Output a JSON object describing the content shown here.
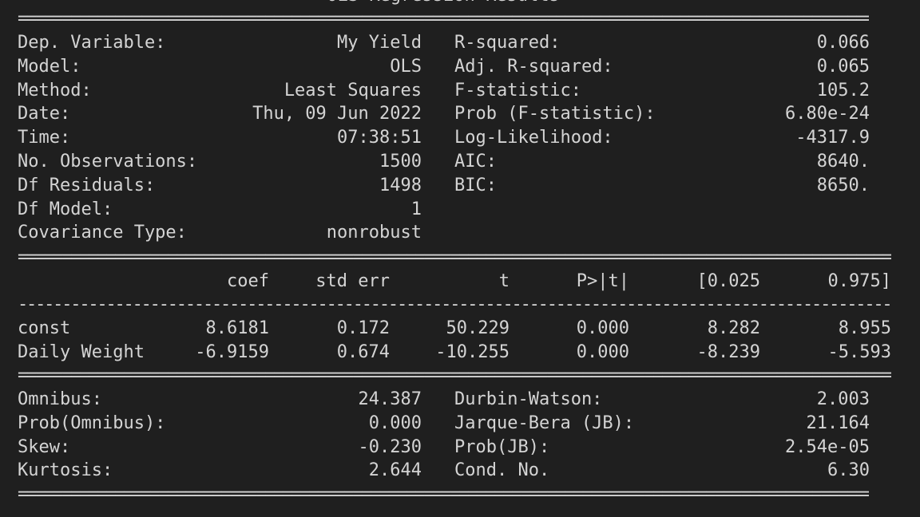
{
  "title": "OLS Regression Results",
  "rule_double": "==========================================================================================================",
  "rule_single": "----------------------------------------------------------------------------------------------------------",
  "summary": {
    "left": [
      {
        "label": "Dep. Variable:",
        "value": "My Yield"
      },
      {
        "label": "Model:",
        "value": "OLS"
      },
      {
        "label": "Method:",
        "value": "Least Squares"
      },
      {
        "label": "Date:",
        "value": "Thu, 09 Jun 2022"
      },
      {
        "label": "Time:",
        "value": "07:38:51"
      },
      {
        "label": "No. Observations:",
        "value": "1500"
      },
      {
        "label": "Df Residuals:",
        "value": "1498"
      },
      {
        "label": "Df Model:",
        "value": "1"
      },
      {
        "label": "Covariance Type:",
        "value": "nonrobust"
      }
    ],
    "right": [
      {
        "label": "R-squared:",
        "value": "0.066"
      },
      {
        "label": "Adj. R-squared:",
        "value": "0.065"
      },
      {
        "label": "F-statistic:",
        "value": "105.2"
      },
      {
        "label": "Prob (F-statistic):",
        "value": "6.80e-24"
      },
      {
        "label": "Log-Likelihood:",
        "value": "-4317.9"
      },
      {
        "label": "AIC:",
        "value": "8640."
      },
      {
        "label": "BIC:",
        "value": "8650."
      }
    ]
  },
  "coef_table": {
    "headers": [
      "coef",
      "std err",
      "t",
      "P>|t|",
      "[0.025",
      "0.975]"
    ],
    "rows": [
      {
        "name": "const",
        "values": [
          "8.6181",
          "0.172",
          "50.229",
          "0.000",
          "8.282",
          "8.955"
        ]
      },
      {
        "name": "Daily Weight",
        "values": [
          "-6.9159",
          "0.674",
          "-10.255",
          "0.000",
          "-8.239",
          "-5.593"
        ]
      }
    ]
  },
  "diagnostics": {
    "left": [
      {
        "label": "Omnibus:",
        "value": "24.387"
      },
      {
        "label": "Prob(Omnibus):",
        "value": "0.000"
      },
      {
        "label": "Skew:",
        "value": "-0.230"
      },
      {
        "label": "Kurtosis:",
        "value": "2.644"
      }
    ],
    "right": [
      {
        "label": "Durbin-Watson:",
        "value": "2.003"
      },
      {
        "label": "Jarque-Bera (JB):",
        "value": "21.164"
      },
      {
        "label": "Prob(JB):",
        "value": "2.54e-05"
      },
      {
        "label": "Cond. No.",
        "value": "6.30"
      }
    ]
  }
}
